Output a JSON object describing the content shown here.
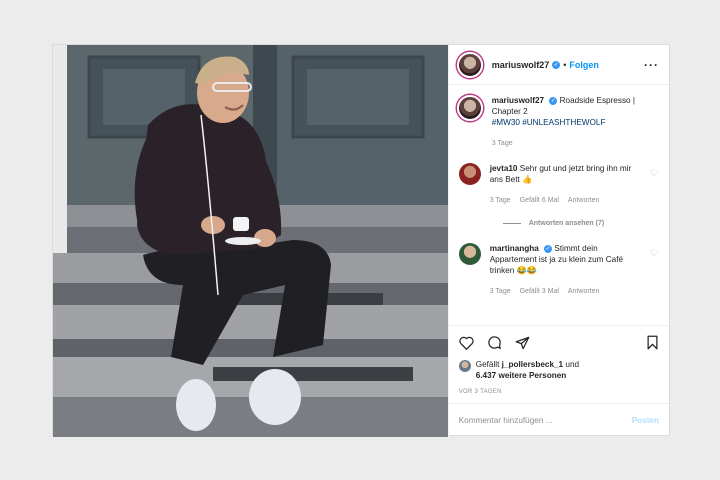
{
  "post": {
    "author": "mariuswolf27",
    "follow_label": "Folgen",
    "more_label": "···",
    "caption": {
      "username": "mariuswolf27",
      "text": "Roadside Espresso | Chapter 2",
      "hashtags": "#MW30 #UNLEASHTHEWOLF",
      "age": "3 Tage"
    },
    "comments": [
      {
        "username": "jevta10",
        "text": "Sehr gut und jetzt bring ihn mir ans Bett 👍",
        "age": "3 Tage",
        "likes": "Gefällt 6 Mal",
        "reply": "Antworten",
        "view_replies": "Antworten ansehen (7)"
      },
      {
        "username": "martinangha",
        "text": "Stimmt dein Appartement ist ja zu klein zum Café trinken 😂😂",
        "age": "3 Tage",
        "likes": "Gefällt 3 Mal",
        "reply": "Antworten"
      }
    ],
    "likes": {
      "prefix": "Gefällt",
      "user": "j_pollersbeck_1",
      "joiner": "und",
      "others": "6.437 weitere Personen"
    },
    "time_ago": "VOR 3 TAGEN",
    "comment_input": {
      "placeholder": "Kommentar hinzufügen ...",
      "post_label": "Posten"
    },
    "colors": {
      "link": "#0095f6",
      "verified": "#3897f0",
      "hashtag": "#00376b",
      "muted": "#8e8e8e"
    },
    "icons": [
      "heart-icon",
      "comment-icon",
      "share-icon",
      "bookmark-icon",
      "verified-icon",
      "more-options-icon"
    ]
  }
}
